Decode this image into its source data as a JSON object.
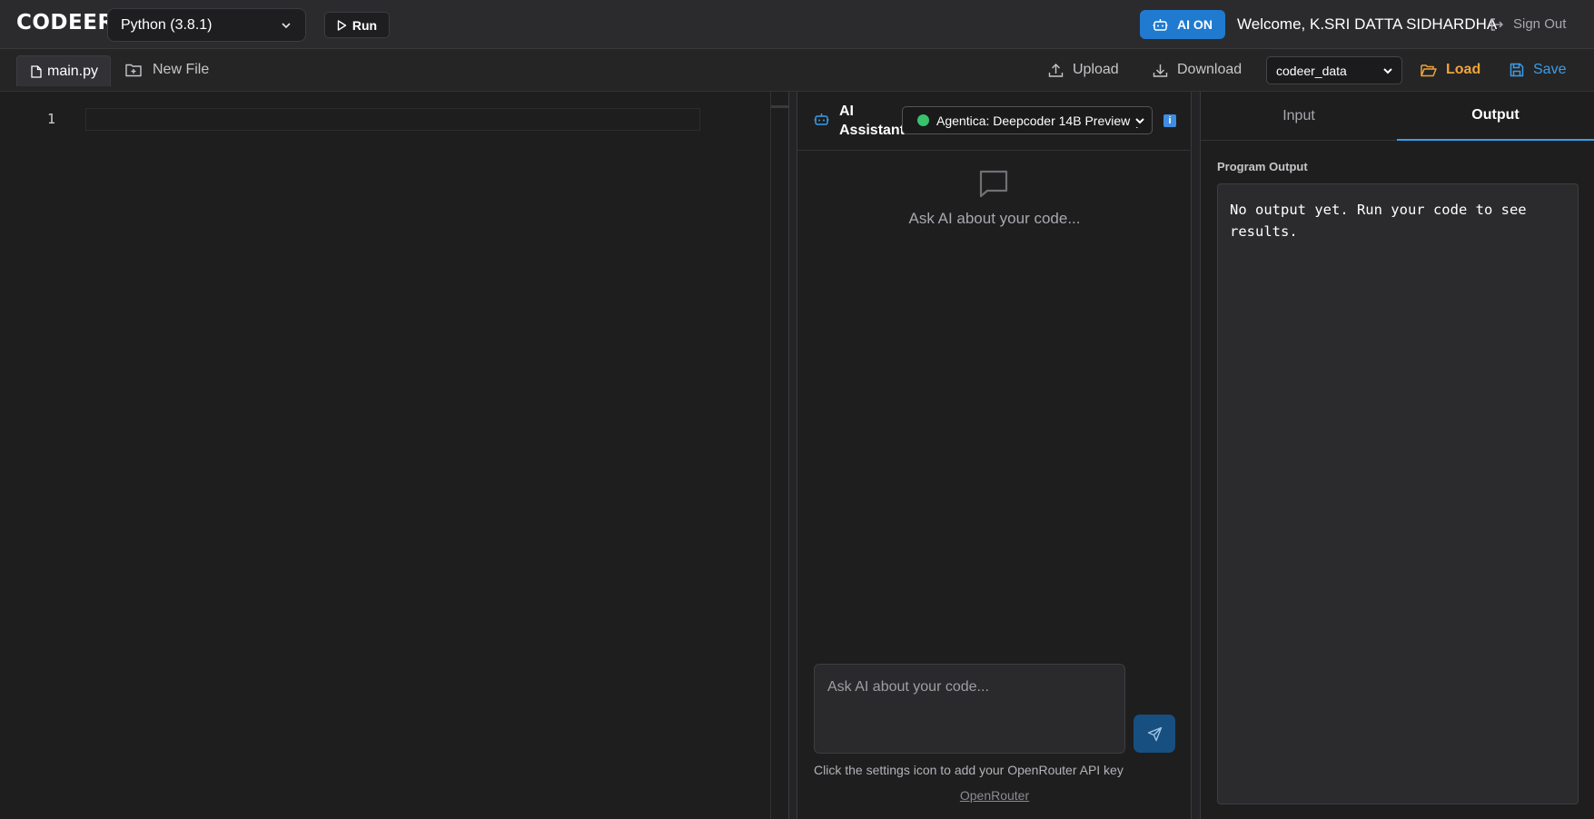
{
  "header": {
    "logo": "CODEER",
    "language": "Python (3.8.1)",
    "run_label": "Run",
    "ai_toggle_label": "AI ON",
    "welcome": "Welcome, K.SRI DATTA SIDHARDHA",
    "signout_label": "Sign Out"
  },
  "filebar": {
    "active_tab": "main.py",
    "new_file_label": "New File",
    "upload_label": "Upload",
    "download_label": "Download",
    "database": "codeer_data",
    "load_label": "Load",
    "save_label": "Save"
  },
  "editor": {
    "line_numbers": [
      "1"
    ]
  },
  "ai_panel": {
    "title": "AI Assistant",
    "model": "Agentica: Deepcoder 14B Preview (",
    "info_badge": "i",
    "empty_text": "Ask AI about your code...",
    "input_placeholder": "Ask AI about your code...",
    "hint": "Click the settings icon to add your OpenRouter API key",
    "link_label": "OpenRouter"
  },
  "output_panel": {
    "tabs": [
      "Input",
      "Output"
    ],
    "active_tab": "Output",
    "label": "Program Output",
    "output_text": "No output yet. Run your code to see results."
  },
  "colors": {
    "accent_blue": "#1f7ad0",
    "load_orange": "#f0a43a",
    "save_blue": "#3b9de8",
    "model_status_green": "#39c16c"
  }
}
